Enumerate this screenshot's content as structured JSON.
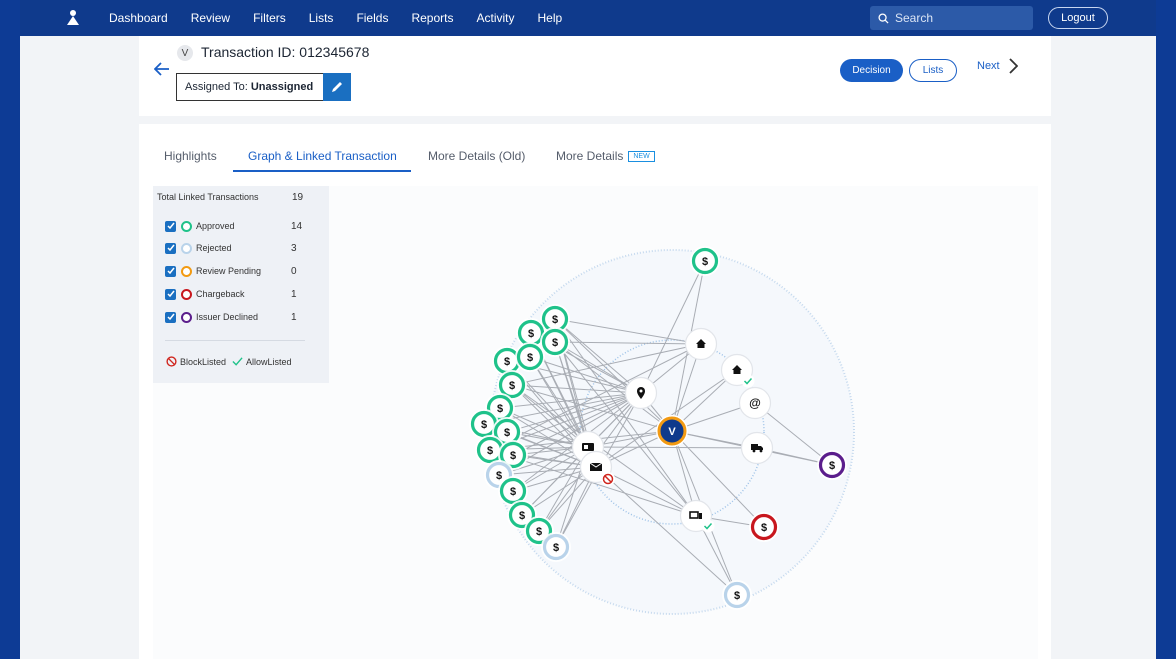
{
  "nav": {
    "items": [
      {
        "label": "Dashboard"
      },
      {
        "label": "Review"
      },
      {
        "label": "Filters"
      },
      {
        "label": "Lists"
      },
      {
        "label": "Fields"
      },
      {
        "label": "Reports"
      },
      {
        "label": "Activity"
      },
      {
        "label": "Help"
      }
    ],
    "search_placeholder": "Search",
    "logout_label": "Logout"
  },
  "header": {
    "badge": "V",
    "title": "Transaction ID: 012345678",
    "assigned_prefix": "Assigned To:",
    "assigned_value": "Unassigned",
    "decision_label": "Decision",
    "lists_label": "Lists",
    "next_label": "Next"
  },
  "tabs": [
    {
      "label": "Highlights"
    },
    {
      "label": "Graph & Linked Transaction"
    },
    {
      "label": "More Details (Old)"
    },
    {
      "label": "More Details",
      "badge": "NEW"
    }
  ],
  "legend": {
    "total_label": "Total Linked Transactions",
    "total_count": "19",
    "rows": [
      {
        "label": "Approved",
        "count": "14",
        "color": "#1fc28a"
      },
      {
        "label": "Rejected",
        "count": "3",
        "color": "#b9d3ea"
      },
      {
        "label": "Review Pending",
        "count": "0",
        "color": "#f29a12"
      },
      {
        "label": "Chargeback",
        "count": "1",
        "color": "#c8171e"
      },
      {
        "label": "Issuer Declined",
        "count": "1",
        "color": "#5b1e8c"
      }
    ],
    "blocklisted_label": "BlockListed",
    "allowlisted_label": "AllowListed"
  },
  "graph": {
    "center_label": "V",
    "money_symbol": "$",
    "icons": [
      "home-icon",
      "location-pin-icon",
      "at-sign-icon",
      "truck-icon",
      "id-card-icon",
      "envelope-icon",
      "device-icon",
      "dollar-icon"
    ]
  }
}
